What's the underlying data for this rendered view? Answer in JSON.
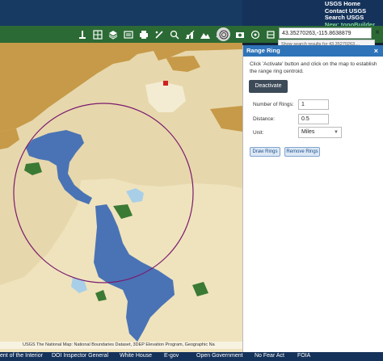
{
  "header": {
    "links": [
      "USGS Home",
      "Contact USGS",
      "Search USGS"
    ],
    "new_link": "New: topoBuilder"
  },
  "toolbar": {
    "tools": [
      "legend-icon",
      "basemap-icon",
      "layers-icon",
      "bookmark-icon",
      "print-icon",
      "draw-icon",
      "measure-icon",
      "search-icon",
      "elevation-icon",
      "profile-icon",
      "range-ring-icon",
      "share-icon",
      "settings-icon",
      "help-icon"
    ],
    "active_tool": "range-ring-icon"
  },
  "search": {
    "value": "43.35270263,-115.8638879",
    "suggestion": "Show search results for 43.35270263,..."
  },
  "panel": {
    "title": "Range Ring",
    "instructions": "Click 'Activate' button and click on the map to establish the range ring centroid.",
    "deactivate_label": "Deactivate",
    "rings_label": "Number of Rings:",
    "rings_value": "1",
    "distance_label": "Distance:",
    "distance_value": "0.5",
    "unit_label": "Unit:",
    "unit_value": "Miles",
    "draw_label": "Draw Rings",
    "remove_label": "Remove Rings"
  },
  "map": {
    "attribution": "USGS The National Map: National Boundaries Dataset, 3DEP Elevation Program, Geographic Na",
    "ring_color": "#7a1b6e",
    "water_color": "#4a73b5",
    "sand_color": "#e7d7ac",
    "brown_color": "#c69a48"
  },
  "footer": {
    "links": [
      "ent of the Interior",
      "DOI Inspector General",
      "White House",
      "E-gov",
      "Open Government",
      "No Fear Act",
      "FOIA"
    ]
  }
}
